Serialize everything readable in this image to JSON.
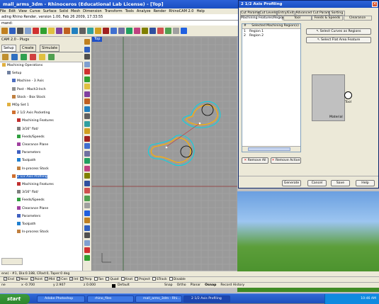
{
  "app": {
    "title": "mall_arms_3dm - Rhinoceros (Educational Lab License) - [Top]",
    "menu": [
      "Edit",
      "View",
      "Curve",
      "Surface",
      "Solid",
      "Mesh",
      "Dimension",
      "Transform",
      "Tools",
      "Analyze",
      "Render",
      "RhinoCAM 2.0",
      "Help"
    ],
    "menu_first": "File",
    "cmd_history": "ading Rhino Render, version 1.00, Feb 26 2009, 17:33:55",
    "cmd_prompt": "mand:"
  },
  "left_panel": {
    "title": "CAM 2.0 - Plugs",
    "tabs": [
      "Setup",
      "Create",
      "Simulate"
    ],
    "tree": [
      {
        "label": "Machining Operations",
        "indent": 0,
        "icon": "folder-icon"
      },
      {
        "label": "Setup",
        "indent": 1,
        "icon": "gear-icon"
      },
      {
        "label": "Machine - 3 Axis",
        "indent": 2,
        "icon": "machine-icon"
      },
      {
        "label": "Post - Mach3-Inch",
        "indent": 2,
        "icon": "post-icon"
      },
      {
        "label": "Stock - Box Stock",
        "indent": 2,
        "icon": "stock-icon"
      },
      {
        "label": "MOp Set 1",
        "indent": 1,
        "icon": "folder-icon"
      },
      {
        "label": "2 1/2 Axis Pocketing",
        "indent": 2,
        "icon": "pocket-icon"
      },
      {
        "label": "Machining Features",
        "indent": 3,
        "icon": "feature-icon"
      },
      {
        "label": "3/16\" flat/",
        "indent": 3,
        "icon": "tool-icon"
      },
      {
        "label": "Feeds/Speeds",
        "indent": 3,
        "icon": "feeds-icon"
      },
      {
        "label": "Clearance Plane",
        "indent": 3,
        "icon": "clearance-icon"
      },
      {
        "label": "Parameters",
        "indent": 3,
        "icon": "parameters-icon"
      },
      {
        "label": "Toolpath",
        "indent": 3,
        "icon": "toolpath-icon"
      },
      {
        "label": "In-process Stock",
        "indent": 3,
        "icon": "stock-icon"
      },
      {
        "label": "2 1/2 Axis Profiling",
        "indent": 2,
        "icon": "profile-icon"
      },
      {
        "label": "Machining Features",
        "indent": 3,
        "icon": "feature-icon"
      },
      {
        "label": "3/16\" flat/",
        "indent": 3,
        "icon": "tool-icon"
      },
      {
        "label": "Feeds/Speeds",
        "indent": 3,
        "icon": "feeds-icon"
      },
      {
        "label": "Clearance Plane",
        "indent": 3,
        "icon": "clearance-icon"
      },
      {
        "label": "Parameters",
        "indent": 3,
        "icon": "parameters-icon"
      },
      {
        "label": "Toolpath",
        "indent": 3,
        "icon": "toolpath-icon"
      },
      {
        "label": "In-process Stock",
        "indent": 3,
        "icon": "stock-icon"
      }
    ]
  },
  "viewport": {
    "label": "Top"
  },
  "status": {
    "row1": "ene) - #1, Dia:0.188, CRad:0, Taper:0 deg",
    "osnaps": [
      "End",
      "Near",
      "Point",
      "Mid",
      "Cen",
      "Int",
      "Perp",
      "Tan",
      "Quad",
      "Knot",
      "Project",
      "STrack",
      "Disable"
    ],
    "osnap_checked": [
      true,
      true,
      true,
      true,
      true,
      true,
      true,
      false,
      false,
      false,
      false,
      false,
      false
    ],
    "plane": "ne",
    "x": "x -0.700",
    "y": "y 2.907",
    "z": "z 0.000",
    "layer": "Default",
    "modes": [
      "Snap",
      "Ortho",
      "Planar",
      "Osnap",
      "Record History"
    ]
  },
  "dialog": {
    "title": "2 1/2 Axis Profiling",
    "tabs_row1": [
      "Cut Parameters",
      "Cut Levels",
      "Entry/Exit",
      "Advanced Cut Parameters",
      "Sorting"
    ],
    "tabs_row2": [
      "Machining Features/Regions",
      "Tool",
      "Feeds & Speeds",
      "Clearance"
    ],
    "list_header": [
      "#",
      "Selected Machining Region(s)"
    ],
    "regions": [
      {
        "n": "1",
        "name": "Region 1"
      },
      {
        "n": "2",
        "name": "Region 2"
      }
    ],
    "btn_curves": "Select Curves as Regions",
    "btn_flat": "Select Flat Area Feature",
    "material_label": "Material",
    "tool_label": "Tool",
    "btn_remove_all": "Remove All",
    "btn_remove_active": "Remove Active",
    "footer": [
      "Generate",
      "Cancel",
      "Save",
      "Help"
    ]
  },
  "taskbar": {
    "start": "start",
    "items": [
      "Adobe Photoshop",
      "rhino_files",
      "mall_arms_3dm - Rhi...",
      "2 1/2 Axis Profiling"
    ],
    "clock": "10:46 AM"
  },
  "colors": {
    "title_blue": "#1a4fc2",
    "viewport": "#9a9a9a",
    "curve_orange": "#ffb000",
    "curve_cyan": "#00d8e8"
  }
}
